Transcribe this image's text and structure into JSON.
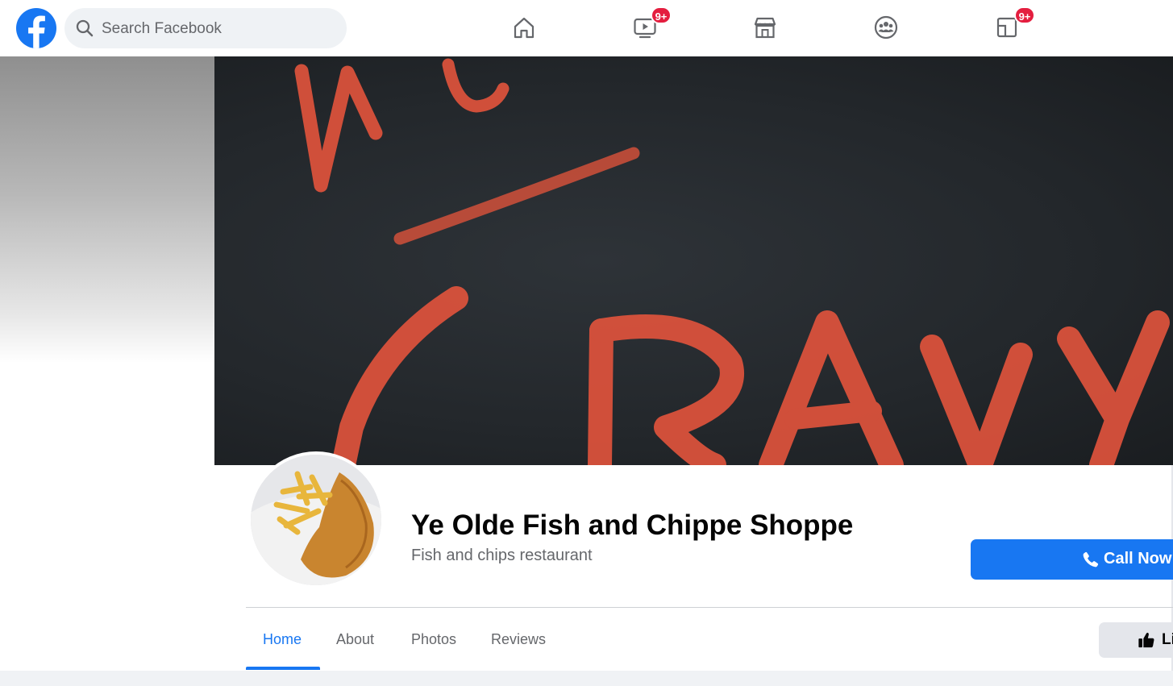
{
  "header": {
    "logo": "facebook-logo",
    "search_placeholder": "Search Facebook",
    "nav": [
      {
        "name": "home",
        "icon": "home-icon",
        "badge": ""
      },
      {
        "name": "watch",
        "icon": "watch-icon",
        "badge": "9+"
      },
      {
        "name": "marketplace",
        "icon": "marketplace-icon",
        "badge": ""
      },
      {
        "name": "groups",
        "icon": "groups-icon",
        "badge": ""
      },
      {
        "name": "gaming",
        "icon": "gaming-icon",
        "badge": "9+"
      }
    ]
  },
  "page": {
    "name": "Ye Olde Fish and Chippe Shoppe",
    "category": "Fish and chips restaurant",
    "call_button": "Call Now",
    "like_button": "Li",
    "tabs": [
      {
        "label": "Home",
        "active": true
      },
      {
        "label": "About",
        "active": false
      },
      {
        "label": "Photos",
        "active": false
      },
      {
        "label": "Reviews",
        "active": false
      }
    ]
  },
  "colors": {
    "brand": "#1877f2",
    "badge": "#e41e3f",
    "cover_chalk": "#e0533c"
  }
}
